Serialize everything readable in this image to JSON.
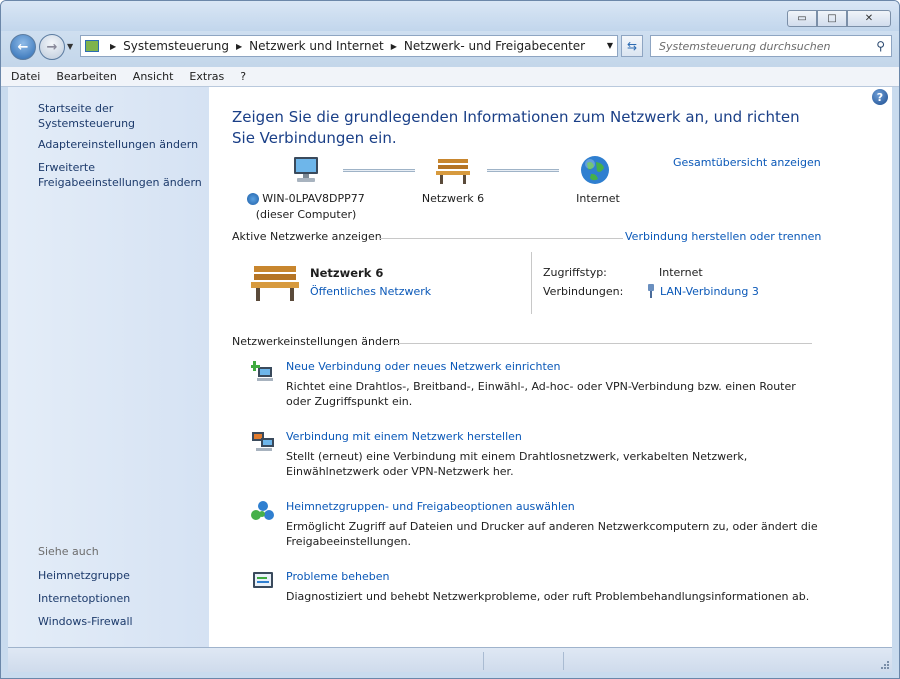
{
  "window": {
    "minimize_glyph": "▭",
    "maximize_glyph": "□",
    "close_glyph": "✕"
  },
  "nav": {
    "back_glyph": "←",
    "forward_glyph": "→",
    "recent_glyph": "▼",
    "breadcrumb": [
      "Systemsteuerung",
      "Netzwerk und Internet",
      "Netzwerk- und Freigabecenter"
    ],
    "breadcrumb_sep": "▶",
    "dropdown_glyph": "▼",
    "refresh_glyph": "⇆",
    "search_placeholder": "Systemsteuerung durchsuchen",
    "search_glyph": "⚲"
  },
  "menu": [
    "Datei",
    "Bearbeiten",
    "Ansicht",
    "Extras",
    "?"
  ],
  "sidebar": {
    "links": [
      "Startseite der Systemsteuerung",
      "Adaptereinstellungen ändern",
      "Erweiterte Freigabeeinstellungen ändern"
    ],
    "see_also_heading": "Siehe auch",
    "see_also": [
      "Heimnetzgruppe",
      "Internetoptionen",
      "Windows-Firewall"
    ]
  },
  "main": {
    "help_glyph": "?",
    "headline": "Zeigen Sie die grundlegenden Informationen zum Netzwerk an, und richten Sie Verbindungen ein.",
    "full_map_link": "Gesamtübersicht anzeigen",
    "map": {
      "computer_name": "WIN-0LPAV8DPP77",
      "computer_sub": "(dieser Computer)",
      "network_name": "Netzwerk  6",
      "internet": "Internet"
    },
    "active_networks_label": "Aktive Netzwerke anzeigen",
    "connect_link": "Verbindung herstellen oder trennen",
    "active": {
      "name": "Netzwerk  6",
      "type_link": "Öffentliches Netzwerk",
      "access_label": "Zugriffstyp:",
      "access_value": "Internet",
      "connections_label": "Verbindungen:",
      "connections_value": "LAN-Verbindung 3"
    },
    "settings_label": "Netzwerkeinstellungen ändern",
    "tasks": [
      {
        "title": "Neue Verbindung oder neues Netzwerk einrichten",
        "desc": "Richtet eine Drahtlos-, Breitband-, Einwähl-, Ad-hoc- oder VPN-Verbindung bzw. einen Router oder Zugriffspunkt ein."
      },
      {
        "title": "Verbindung mit einem Netzwerk herstellen",
        "desc": "Stellt (erneut) eine Verbindung mit einem Drahtlosnetzwerk, verkabelten Netzwerk, Einwählnetzwerk oder VPN-Netzwerk her."
      },
      {
        "title": "Heimnetzgruppen- und Freigabeoptionen auswählen",
        "desc": "Ermöglicht Zugriff auf Dateien und Drucker auf anderen Netzwerkcomputern zu, oder ändert die Freigabeeinstellungen."
      },
      {
        "title": "Probleme beheben",
        "desc": "Diagnostiziert und behebt Netzwerkprobleme, oder ruft Problembehandlungsinformationen ab."
      }
    ]
  }
}
